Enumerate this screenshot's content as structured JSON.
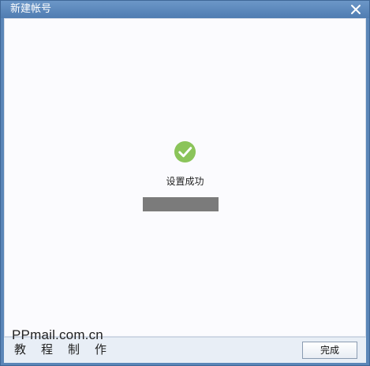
{
  "window": {
    "title": "新建帐号"
  },
  "content": {
    "status_text": "设置成功",
    "progress": 1.0
  },
  "footer": {
    "watermark_line1": "PPmail.com.cn",
    "watermark_line2": "教程制作",
    "finish_label": "完成"
  },
  "icons": {
    "close": "close-icon",
    "success": "check-circle-icon"
  },
  "colors": {
    "titlebar": "#5b86b8",
    "success_green": "#8bc45a",
    "progress_fill": "#7b7b7b"
  }
}
